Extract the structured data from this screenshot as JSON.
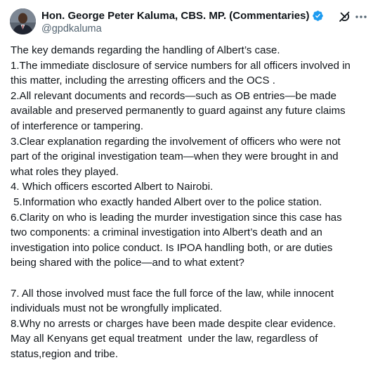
{
  "author": {
    "display_name": "Hon. George Peter Kaluma, CBS. MP. (Commentaries)",
    "handle": "@gpdkaluma",
    "verified_color": "#1d9bf0"
  },
  "icons": {
    "verified": "verified-badge-icon",
    "grok": "grok-icon",
    "more": "more-options-icon"
  },
  "tweet": {
    "lines": [
      "The key demands regarding the handling of Albert’s case.",
      "1.The immediate disclosure of service numbers for all officers involved in",
      "this matter, including the arresting officers and the OCS .",
      "2.All relevant documents and records—such as OB entries—be made",
      "available and preserved permanently to guard against any future claims",
      "of interference or tampering.",
      "3.Clear explanation regarding the involvement of officers who were not",
      "part of the original investigation team—when they were brought in and",
      "what roles they played.",
      "4. Which officers escorted Albert to Nairobi.",
      " 5.Information who exactly handed Albert over to the police station.",
      "6.Clarity on who is leading the murder investigation since this case has",
      "two components: a criminal investigation into Albert’s death and an",
      "investigation into police conduct. Is IPOA handling both, or are duties",
      "being shared with the police—and to what extent?",
      "",
      "7. All those involved must face the full force of the law, while innocent",
      "individuals must not be wrongfully implicated.",
      "8.Why no arrests or charges have been made despite clear evidence.",
      "May all Kenyans get equal treatment  under the law, regardless of",
      "status,region and tribe."
    ]
  }
}
